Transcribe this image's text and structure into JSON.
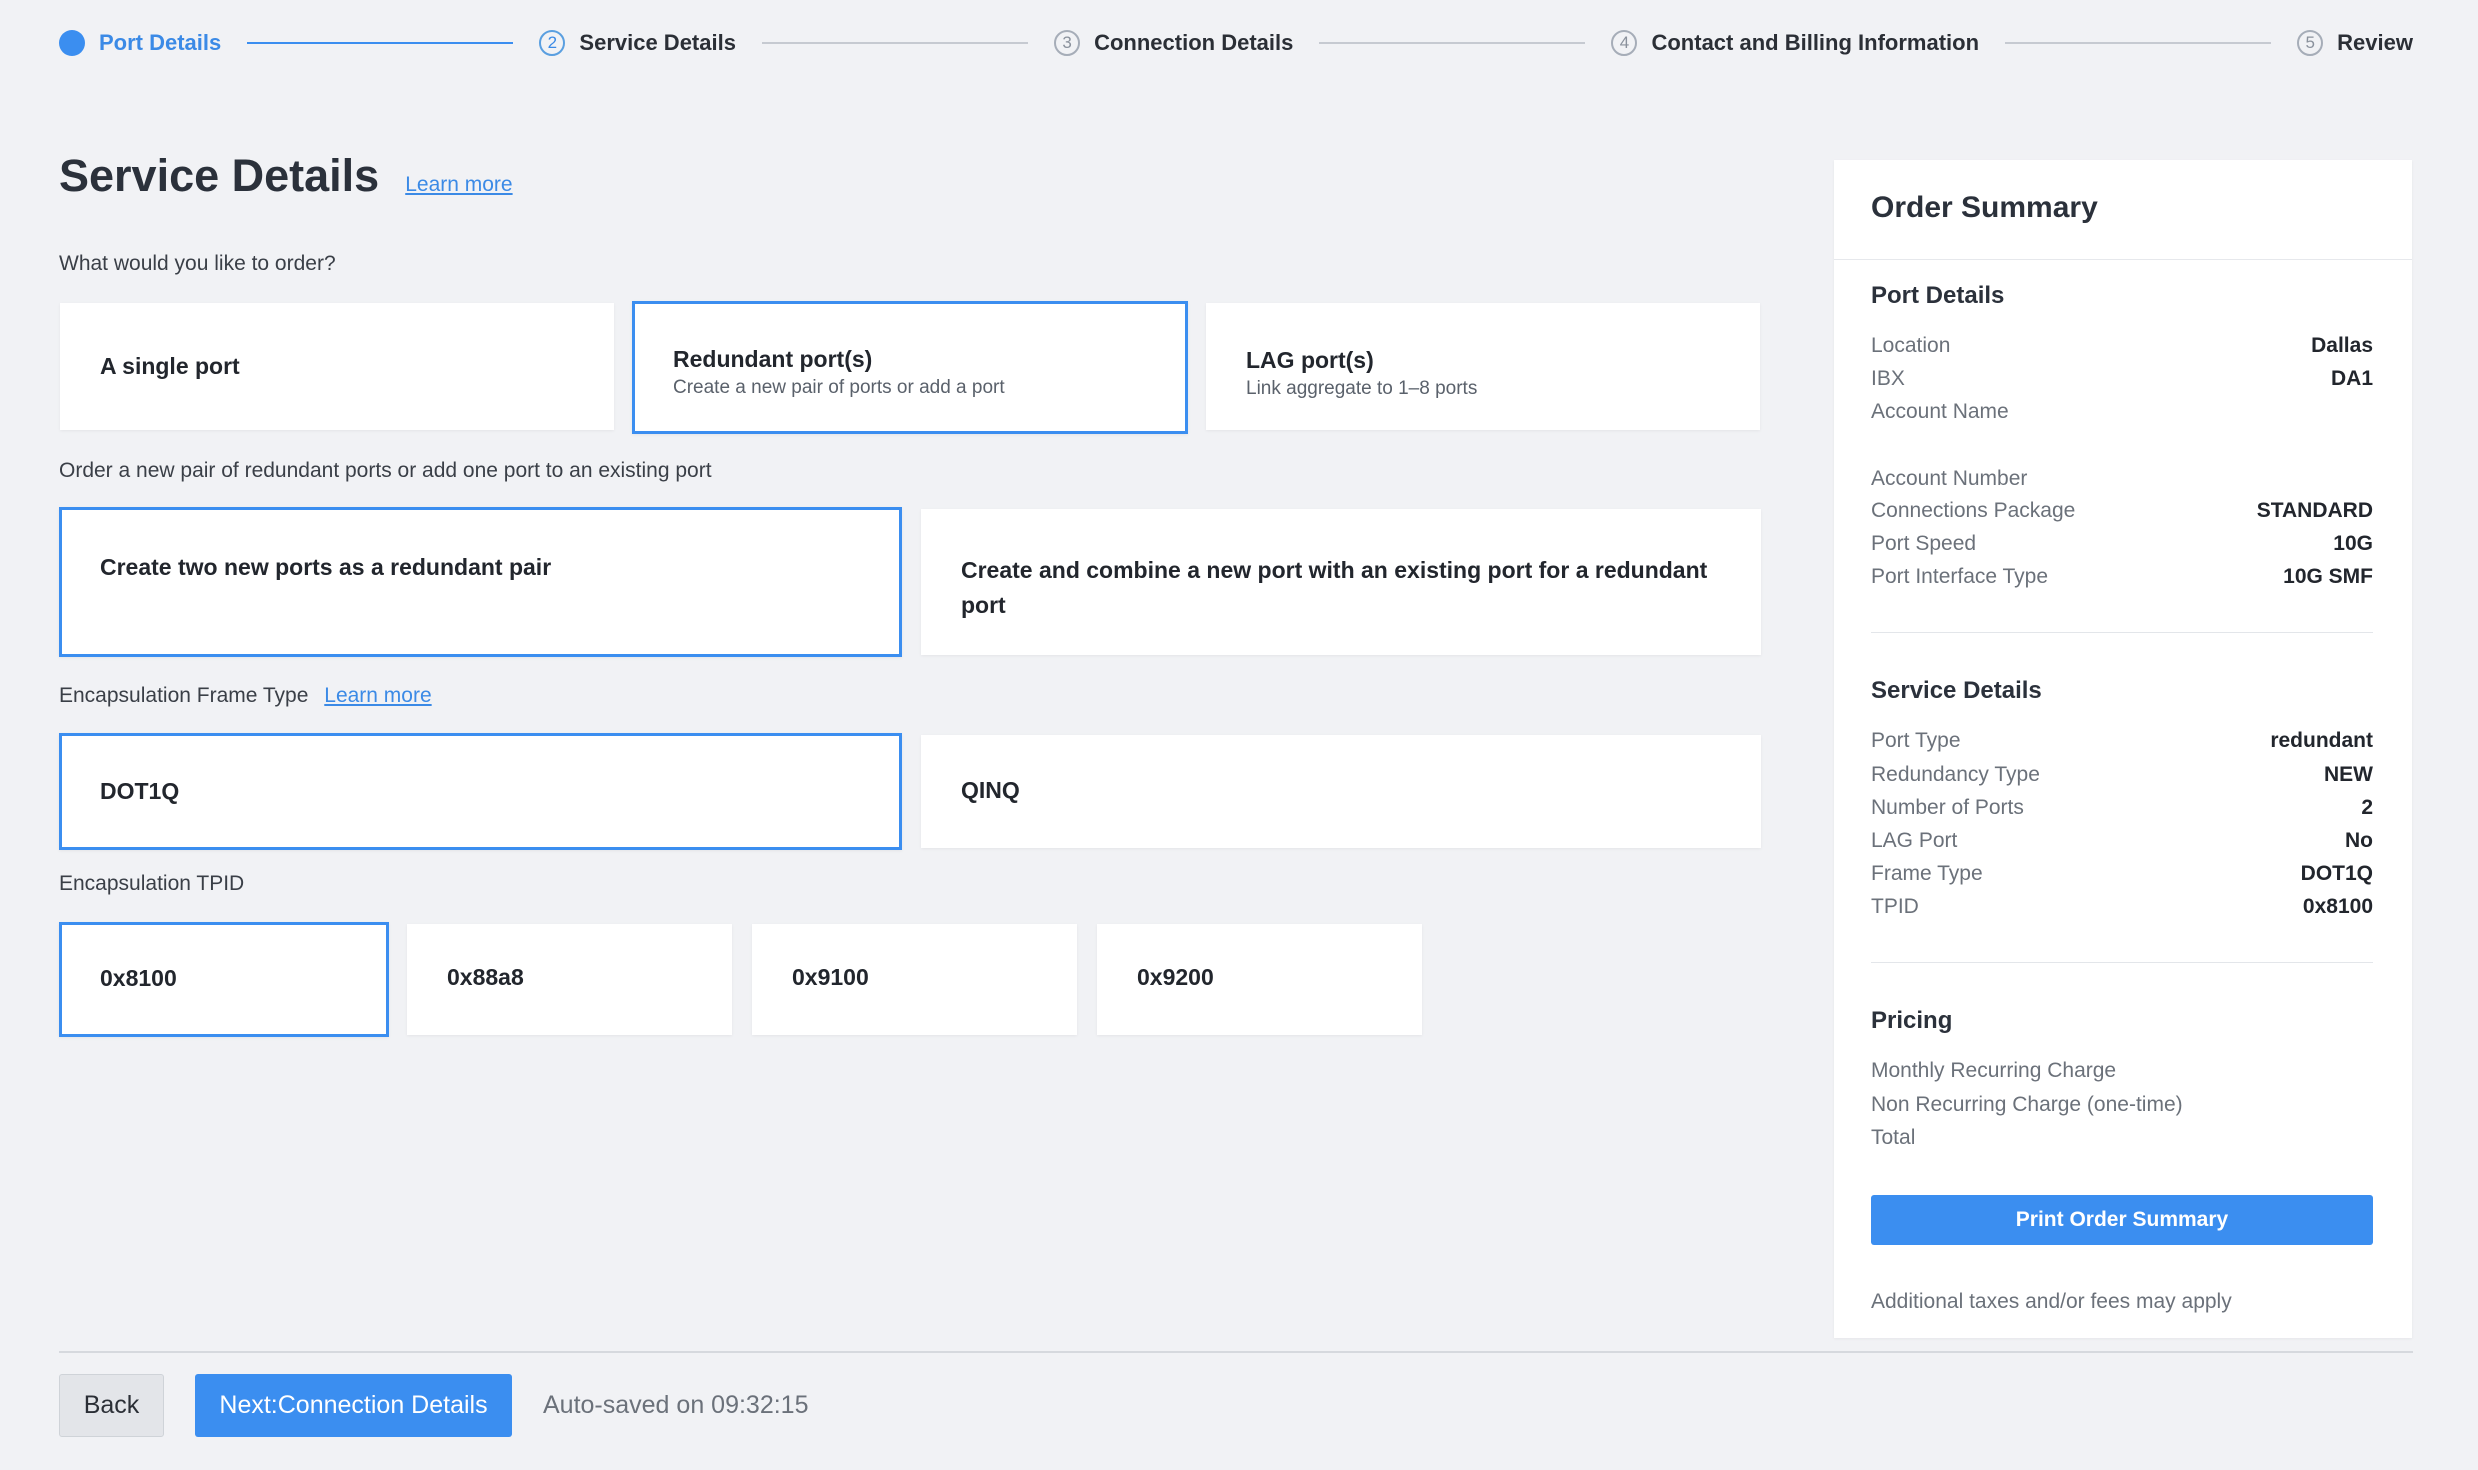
{
  "stepper": {
    "steps": [
      {
        "num": "",
        "label": "Port Details",
        "state": "done"
      },
      {
        "num": "2",
        "label": "Service Details",
        "state": "current"
      },
      {
        "num": "3",
        "label": "Connection Details",
        "state": "upcoming"
      },
      {
        "num": "4",
        "label": "Contact and Billing Information",
        "state": "upcoming"
      },
      {
        "num": "5",
        "label": "Review",
        "state": "upcoming"
      }
    ]
  },
  "main": {
    "title": "Service Details",
    "learn_more": "Learn more",
    "order_question": "What would you like to order?",
    "port_options": [
      {
        "title": "A single port",
        "subtitle": ""
      },
      {
        "title": "Redundant port(s)",
        "subtitle": "Create a new pair of ports or add a port"
      },
      {
        "title": "LAG port(s)",
        "subtitle": "Link aggregate to 1–8 ports"
      }
    ],
    "redundant_question": "Order a new pair of redundant ports or add one port to an existing port",
    "redundant_options": [
      {
        "title": "Create two new ports as a redundant pair"
      },
      {
        "title": "Create and combine a new port with an existing port for a redundant port"
      }
    ],
    "frame_label": "Encapsulation Frame Type",
    "frame_learn_more": "Learn more",
    "frame_options": [
      {
        "title": "DOT1Q"
      },
      {
        "title": "QINQ"
      }
    ],
    "tpid_label": "Encapsulation TPID",
    "tpid_options": [
      {
        "title": "0x8100"
      },
      {
        "title": "0x88a8"
      },
      {
        "title": "0x9100"
      },
      {
        "title": "0x9200"
      }
    ]
  },
  "summary": {
    "title": "Order Summary",
    "port_details": {
      "title": "Port Details",
      "rows": [
        {
          "key": "Location",
          "value": "Dallas"
        },
        {
          "key": "IBX",
          "value": "DA1"
        },
        {
          "key": "Account Name",
          "value": ""
        },
        {
          "key": "Account Number",
          "value": ""
        },
        {
          "key": "Connections Package",
          "value": "STANDARD"
        },
        {
          "key": "Port Speed",
          "value": "10G"
        },
        {
          "key": "Port Interface Type",
          "value": "10G SMF"
        }
      ]
    },
    "service_details": {
      "title": "Service Details",
      "rows": [
        {
          "key": "Port Type",
          "value": "redundant"
        },
        {
          "key": "Redundancy Type",
          "value": "NEW"
        },
        {
          "key": "Number of Ports",
          "value": "2"
        },
        {
          "key": "LAG Port",
          "value": "No"
        },
        {
          "key": "Frame Type",
          "value": "DOT1Q"
        },
        {
          "key": "TPID",
          "value": "0x8100"
        }
      ]
    },
    "pricing": {
      "title": "Pricing",
      "rows": [
        {
          "key": "Monthly Recurring Charge",
          "value": ""
        },
        {
          "key": "Non Recurring Charge (one-time)",
          "value": ""
        },
        {
          "key": "Total",
          "value": ""
        }
      ]
    },
    "print_label": "Print Order Summary",
    "tax_note": "Additional taxes and/or fees may apply"
  },
  "footer": {
    "back_label": "Back",
    "next_label": "Next:Connection Details",
    "autosave": "Auto-saved on 09:32:15"
  },
  "colors": {
    "accent": "#3b8ef0",
    "background": "#f1f2f5"
  }
}
